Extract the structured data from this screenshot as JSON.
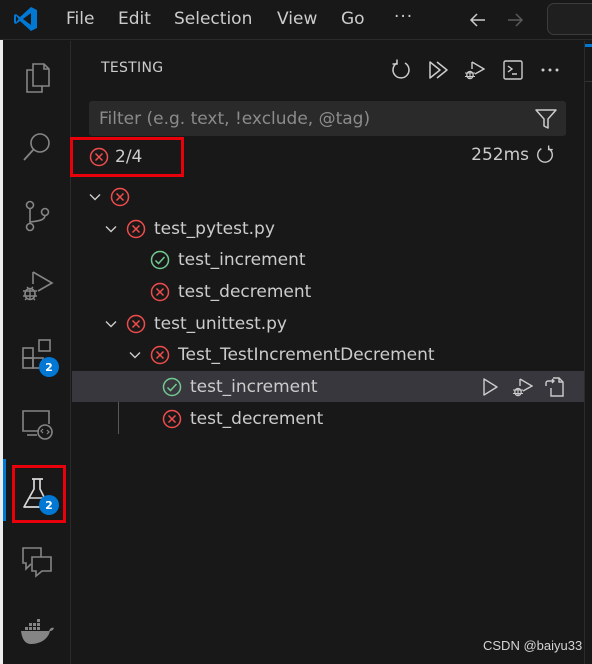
{
  "titlebar": {
    "menu": [
      "File",
      "Edit",
      "Selection",
      "View",
      "Go"
    ],
    "more": "···",
    "back_icon": "arrow-left-icon",
    "forward_icon": "arrow-right-icon"
  },
  "activity_bar": {
    "items": [
      {
        "name": "explorer",
        "icon": "files-icon"
      },
      {
        "name": "search",
        "icon": "search-icon"
      },
      {
        "name": "source-control",
        "icon": "source-control-icon"
      },
      {
        "name": "run-and-debug",
        "icon": "debug-icon"
      },
      {
        "name": "extensions",
        "icon": "extensions-icon",
        "badge": "2"
      },
      {
        "name": "remote-explorer",
        "icon": "remote-explorer-icon"
      },
      {
        "name": "testing",
        "icon": "beaker-icon",
        "badge": "2",
        "active": true
      },
      {
        "name": "chat",
        "icon": "chat-icon"
      },
      {
        "name": "docker",
        "icon": "docker-icon"
      }
    ]
  },
  "sidebar": {
    "title": "TESTING",
    "toolbar": [
      "refresh-icon",
      "run-all-icon",
      "debug-all-icon",
      "terminal-icon",
      "more-icon"
    ],
    "filter": {
      "placeholder": "Filter (e.g. text, !exclude, @tag)",
      "value": ""
    },
    "summary": {
      "status": "failed",
      "count": "2/4",
      "duration": "252ms"
    },
    "tree": [
      {
        "label": "",
        "status": "failed",
        "level": 0,
        "expanded": true
      },
      {
        "label": "test_pytest.py",
        "status": "failed",
        "level": 1,
        "expanded": true
      },
      {
        "label": "test_increment",
        "status": "passed",
        "level": 2
      },
      {
        "label": "test_decrement",
        "status": "failed",
        "level": 2
      },
      {
        "label": "test_unittest.py",
        "status": "failed",
        "level": 1,
        "expanded": true
      },
      {
        "label": "Test_TestIncrementDecrement",
        "status": "failed",
        "level": 2,
        "expanded": true
      },
      {
        "label": "test_increment",
        "status": "passed",
        "level": 3,
        "selected": true
      },
      {
        "label": "test_decrement",
        "status": "failed",
        "level": 3
      }
    ],
    "row_actions": [
      "run-test-icon",
      "debug-test-icon",
      "go-to-test-icon"
    ]
  },
  "colors": {
    "failed": "#f14c4c",
    "passed": "#73c991",
    "accent": "#0078d4",
    "highlight_box": "#e8000b"
  },
  "watermark": "CSDN @baiyu33"
}
